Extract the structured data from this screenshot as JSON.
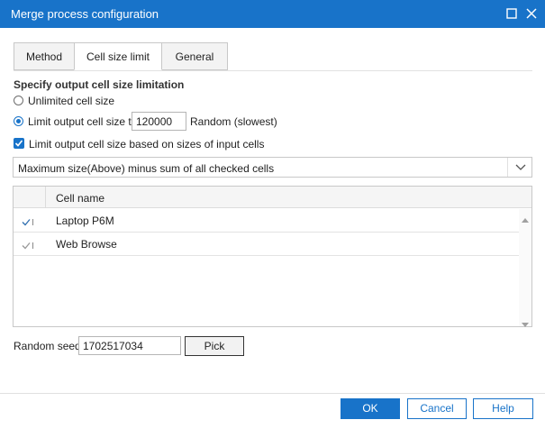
{
  "window": {
    "title": "Merge process configuration",
    "icons": [
      "maximize-icon",
      "close-icon"
    ]
  },
  "tabs": [
    {
      "label": "Method"
    },
    {
      "label": "Cell size limit",
      "active": true
    },
    {
      "label": "General"
    }
  ],
  "section": {
    "title": "Specify output cell size limitation"
  },
  "options": {
    "unlimited_label": "Unlimited cell size",
    "limit_label": "Limit output cell size to",
    "limit_value": "120000",
    "random_label": "Random (slowest)",
    "limit_checked": true,
    "based_on_inputs_label": "Limit output cell size based on sizes of input cells",
    "based_on_inputs_checked": true
  },
  "dropdown": {
    "value": "Maximum size(Above) minus sum of all checked cells"
  },
  "grid": {
    "header": "Cell name",
    "rows": [
      {
        "name": "Laptop P6M",
        "checked": true
      },
      {
        "name": "Web Browse",
        "checked": true
      }
    ]
  },
  "seed": {
    "label": "Random seed",
    "value": "1702517034",
    "pick_label": "Pick"
  },
  "footer": {
    "ok": "OK",
    "cancel": "Cancel",
    "help": "Help"
  },
  "colors": {
    "accent": "#1873c9",
    "title_text": "#ffffff"
  }
}
